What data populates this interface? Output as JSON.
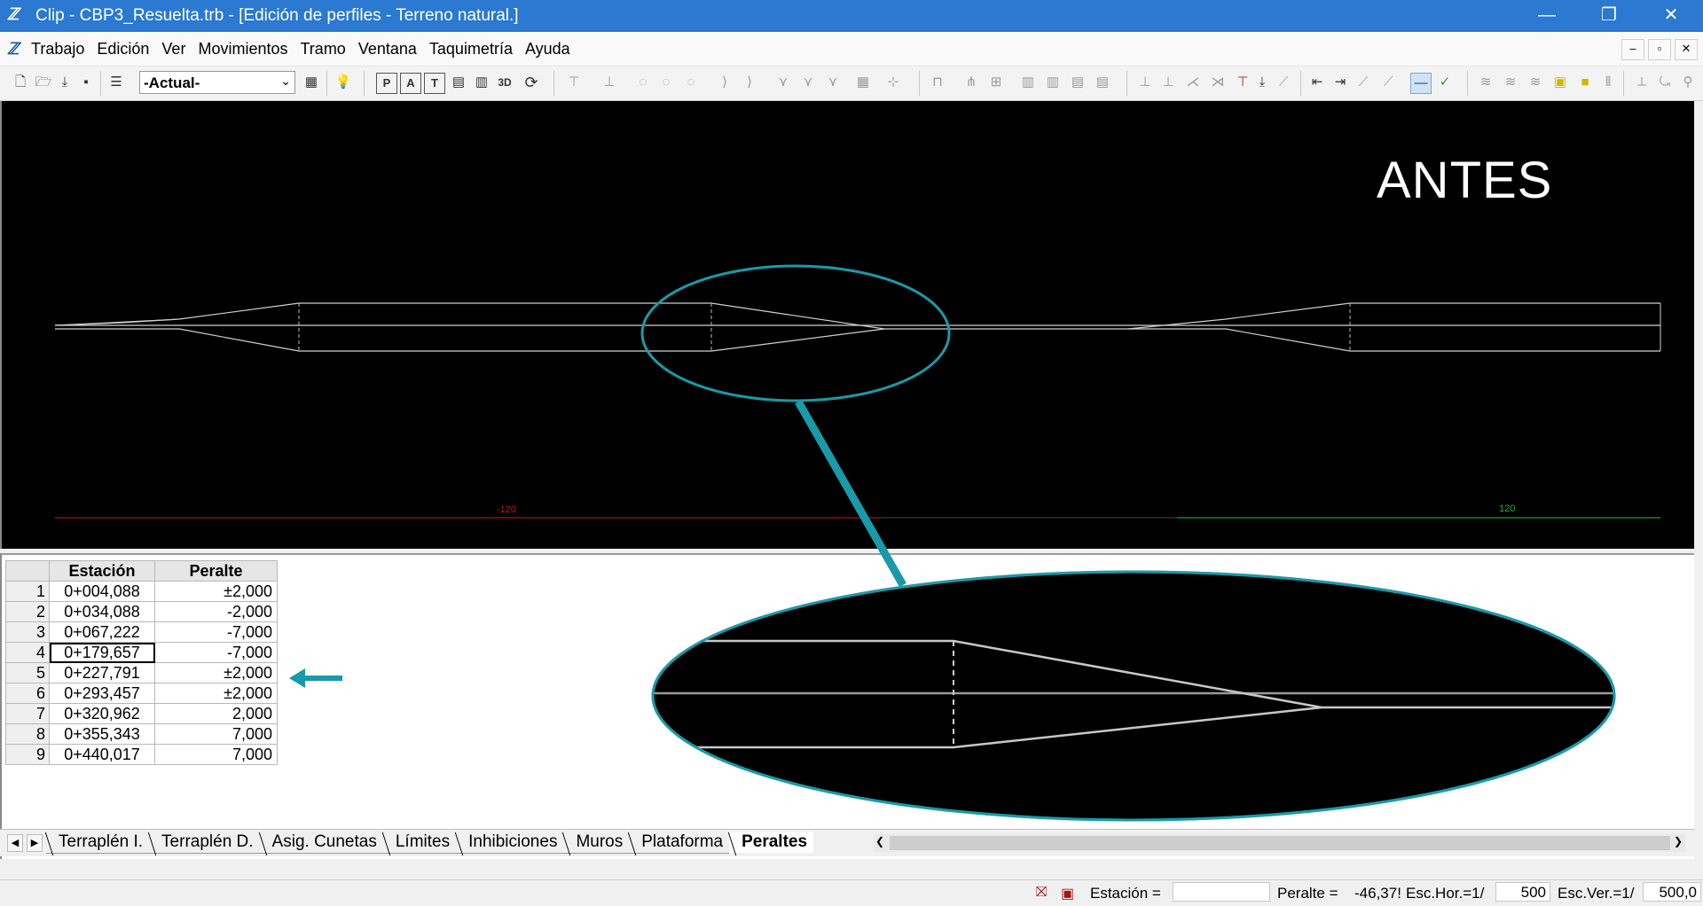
{
  "window": {
    "title": "Clip - CBP3_Resuelta.trb - [Edición de perfiles - Terreno natural.]",
    "minimize_glyph": "—",
    "maximize_glyph": "❐",
    "close_glyph": "✕"
  },
  "menu": {
    "items": [
      "Trabajo",
      "Edición",
      "Ver",
      "Movimientos",
      "Tramo",
      "Ventana",
      "Taquimetría",
      "Ayuda"
    ],
    "mdi_buttons": [
      "–",
      "▫",
      "✕"
    ]
  },
  "toolbar": {
    "combo_value": "-Actual-",
    "text_buttons": [
      "P",
      "A",
      "T",
      "3D"
    ]
  },
  "canvas": {
    "overlay_text": "ANTES",
    "axis_left_label": "-120",
    "axis_right_label": "120",
    "colors": {
      "background": "#000000",
      "profile": "#d0d0d0",
      "axis_left": "#b01010",
      "axis_right": "#10a020",
      "highlight": "#1a9aa8"
    }
  },
  "table": {
    "headers": [
      "Estación",
      "Peralte"
    ],
    "rows": [
      {
        "n": "1",
        "estacion": "0+004,088",
        "peralte": "±2,000"
      },
      {
        "n": "2",
        "estacion": "0+034,088",
        "peralte": "-2,000"
      },
      {
        "n": "3",
        "estacion": "0+067,222",
        "peralte": "-7,000"
      },
      {
        "n": "4",
        "estacion": "0+179,657",
        "peralte": "-7,000"
      },
      {
        "n": "5",
        "estacion": "0+227,791",
        "peralte": "±2,000"
      },
      {
        "n": "6",
        "estacion": "0+293,457",
        "peralte": "±2,000"
      },
      {
        "n": "7",
        "estacion": "0+320,962",
        "peralte": "2,000"
      },
      {
        "n": "8",
        "estacion": "0+355,343",
        "peralte": "7,000"
      },
      {
        "n": "9",
        "estacion": "0+440,017",
        "peralte": "7,000"
      }
    ],
    "selected_row": "4"
  },
  "tabs": {
    "items": [
      "Terraplén  I.",
      "Terraplén  D.",
      "Asig. Cunetas",
      "Límites",
      "Inhibiciones",
      "Muros",
      "Plataforma",
      "Peraltes"
    ],
    "active": "Peraltes"
  },
  "status": {
    "estacion_label": "Estación =",
    "estacion_value": "",
    "peralte_label": "Peralte =",
    "peralte_value": "-46,37!",
    "esc_hor_label": "Esc.Hor.=1/",
    "esc_hor_value": "500",
    "esc_ver_label": "Esc.Ver.=1/",
    "esc_ver_value": "500,0"
  }
}
